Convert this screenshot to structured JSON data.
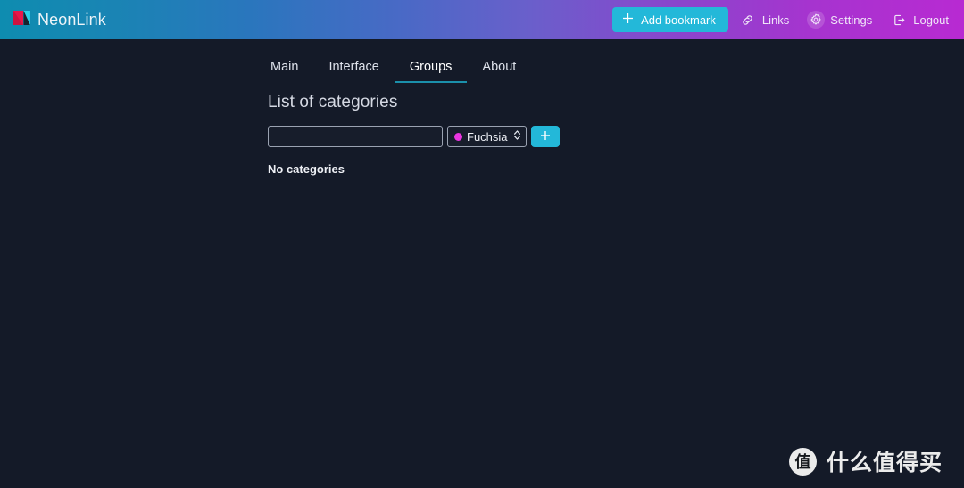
{
  "app": {
    "name": "NeonLink",
    "logo_icon": "neonlink-logo-icon"
  },
  "header": {
    "gradient_start": "#0e8cb0",
    "gradient_mid": "#5a63c4",
    "gradient_end": "#b82ad2",
    "add_bookmark": {
      "label": "Add bookmark",
      "icon": "plus-icon",
      "color": "#23b8d9"
    },
    "links": [
      {
        "label": "Links",
        "icon": "link-chain-icon",
        "active": false
      },
      {
        "label": "Settings",
        "icon": "gear-icon",
        "active": true
      },
      {
        "label": "Logout",
        "icon": "logout-icon",
        "active": false
      }
    ]
  },
  "tabs": [
    {
      "label": "Main",
      "active": false
    },
    {
      "label": "Interface",
      "active": false
    },
    {
      "label": "Groups",
      "active": true
    },
    {
      "label": "About",
      "active": false
    }
  ],
  "tab_accent": "#1b90ab",
  "panel": {
    "title": "List of categories",
    "category_input": {
      "value": "",
      "placeholder": ""
    },
    "color_select": {
      "selected": "Fuchsia",
      "swatch_color": "#e935e0",
      "caret_icon": "chevron-up-down-icon",
      "options": [
        "Fuchsia"
      ]
    },
    "add_button": {
      "label": "+",
      "icon": "plus-icon",
      "color": "#23b8d9"
    },
    "empty_message": "No categories"
  },
  "watermark": {
    "badge": "值",
    "text": "什么值得买"
  }
}
